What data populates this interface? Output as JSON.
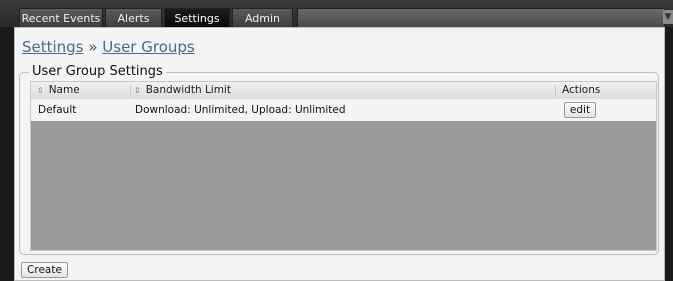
{
  "tabs": [
    {
      "label": "Recent Events",
      "active": false
    },
    {
      "label": "Alerts",
      "active": false
    },
    {
      "label": "Settings",
      "active": true
    },
    {
      "label": "Admin",
      "active": false
    }
  ],
  "breadcrumb": {
    "root": "Settings",
    "separator": "»",
    "current": "User Groups"
  },
  "section": {
    "legend": "User Group Settings"
  },
  "table": {
    "columns": [
      "Name",
      "Bandwidth Limit",
      "Actions"
    ],
    "rows": [
      {
        "name": "Default",
        "bandwidth_limit": "Download: Unlimited, Upload: Unlimited",
        "action": "edit"
      }
    ]
  },
  "buttons": {
    "create": "Create"
  },
  "colors": {
    "breadcrumb_link": "#4a6a86",
    "active_tab": "#0a0a0a",
    "empty_table_area": "#9a9a9a"
  }
}
